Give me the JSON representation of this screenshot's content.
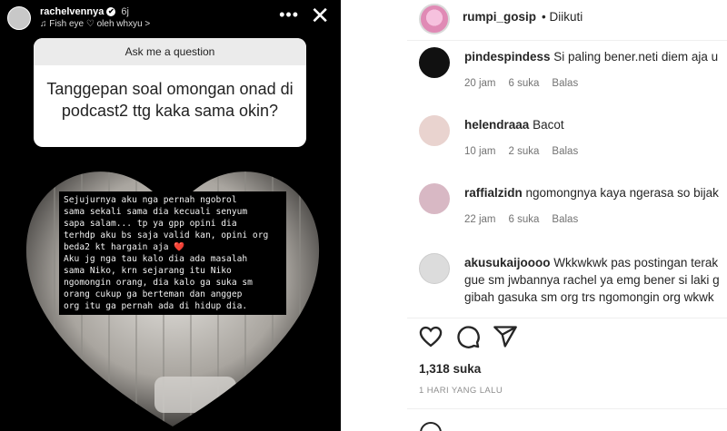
{
  "story": {
    "username": "rachelvennya",
    "time": "6j",
    "music": "Fish eye ♡ oleh whxyu >",
    "question": {
      "header": "Ask me a question",
      "text": "Tanggepan soal omongan onad di podcast2 ttg kaka sama okin?"
    },
    "answer_lines": [
      "Sejujurnya aku nga pernah ngobrol",
      "sama sekali sama dia kecuali senyum",
      "sapa salam... tp ya gpp opini dia",
      "terhdp aku bs saja valid kan, opini org",
      "beda2 kt hargain aja ❤️",
      "Aku jg nga tau kalo dia ada masalah",
      "sama Niko, krn sejarang itu Niko",
      "ngomongin orang, dia kalo ga suka sm",
      "orang cukup ga berteman dan anggep",
      "org itu ga pernah ada di hidup dia."
    ]
  },
  "post": {
    "username": "rumpi_gosip",
    "follow_status": "Diikuti",
    "separator": "•",
    "comments": [
      {
        "user": "pindespindess",
        "text": "Si paling bener.neti diem aja u",
        "time": "20 jam",
        "likes": "6 suka",
        "reply": "Balas",
        "avatar_color": "#111111"
      },
      {
        "user": "helendraaa",
        "text": "Bacot",
        "time": "10 jam",
        "likes": "2 suka",
        "reply": "Balas",
        "avatar_color": "#e9d3cf"
      },
      {
        "user": "raffialzidn",
        "text": "ngomongnya kaya ngerasa so bijak",
        "time": "22 jam",
        "likes": "6 suka",
        "reply": "Balas",
        "avatar_color": "#d8b8c4"
      },
      {
        "user": "akusukaijoooo",
        "text": "Wkkwkwk pas postingan terak",
        "text2": "gue sm jwbannya rachel ya emg bener si laki g",
        "text3": "gibah gasuka sm org trs ngomongin org wkwk",
        "avatar_color": "#dcdcdc"
      }
    ],
    "likes_count": "1,318 suka",
    "date": "1 HARI YANG LALU",
    "icons": [
      "heart-icon",
      "comment-icon",
      "share-icon",
      "emoji-icon"
    ]
  }
}
